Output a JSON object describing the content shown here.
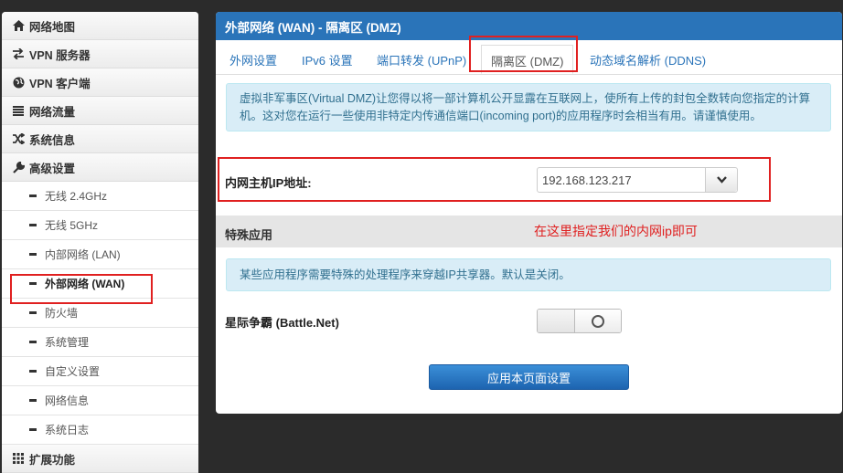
{
  "sidebar": {
    "items": [
      {
        "label": "网络地图",
        "icon": "home-icon",
        "glyph": "⌂"
      },
      {
        "label": "VPN 服务器",
        "icon": "vpn-server-icon",
        "glyph": "⇆"
      },
      {
        "label": "VPN 客户端",
        "icon": "globe-icon",
        "glyph": "●"
      },
      {
        "label": "网络流量",
        "icon": "list-icon",
        "glyph": "≣"
      },
      {
        "label": "系统信息",
        "icon": "shuffle-icon",
        "glyph": "⤨"
      },
      {
        "label": "高级设置",
        "icon": "wrench-icon",
        "glyph": "✎"
      }
    ],
    "sub_items": [
      "无线 2.4GHz",
      "无线 5GHz",
      "内部网络 (LAN)",
      "外部网络 (WAN)",
      "防火墙",
      "系统管理",
      "自定义设置",
      "网络信息",
      "系统日志"
    ],
    "active_sub": "外部网络 (WAN)",
    "extra": {
      "label": "扩展功能",
      "icon": "grid-icon",
      "glyph": "▦"
    }
  },
  "panel": {
    "title": "外部网络 (WAN) - 隔离区 (DMZ)",
    "tabs": [
      "外网设置",
      "IPv6 设置",
      "端口转发 (UPnP)",
      "隔离区 (DMZ)",
      "动态域名解析 (DDNS)"
    ],
    "active_tab": "隔离区 (DMZ)",
    "info_text": "虚拟非军事区(Virtual DMZ)让您得以将一部计算机公开显露在互联网上，使所有上传的封包全数转向您指定的计算机。这对您在运行一些使用非特定内传通信端口(incoming port)的应用程序时会相当有用。请谨慎使用。",
    "host_ip_label": "内网主机IP地址:",
    "host_ip_value": "192.168.123.217",
    "special_title": "特殊应用",
    "annotation": "在这里指定我们的内网ip即可",
    "special_info": "某些应用程序需要特殊的处理程序来穿越IP共享器。默认是关闭。",
    "battlenet_label": "星际争霸 (Battle.Net)",
    "battlenet_enabled": false,
    "apply_label": "应用本页面设置"
  },
  "colors": {
    "header": "#2a74b9",
    "annotation": "#e02020"
  }
}
